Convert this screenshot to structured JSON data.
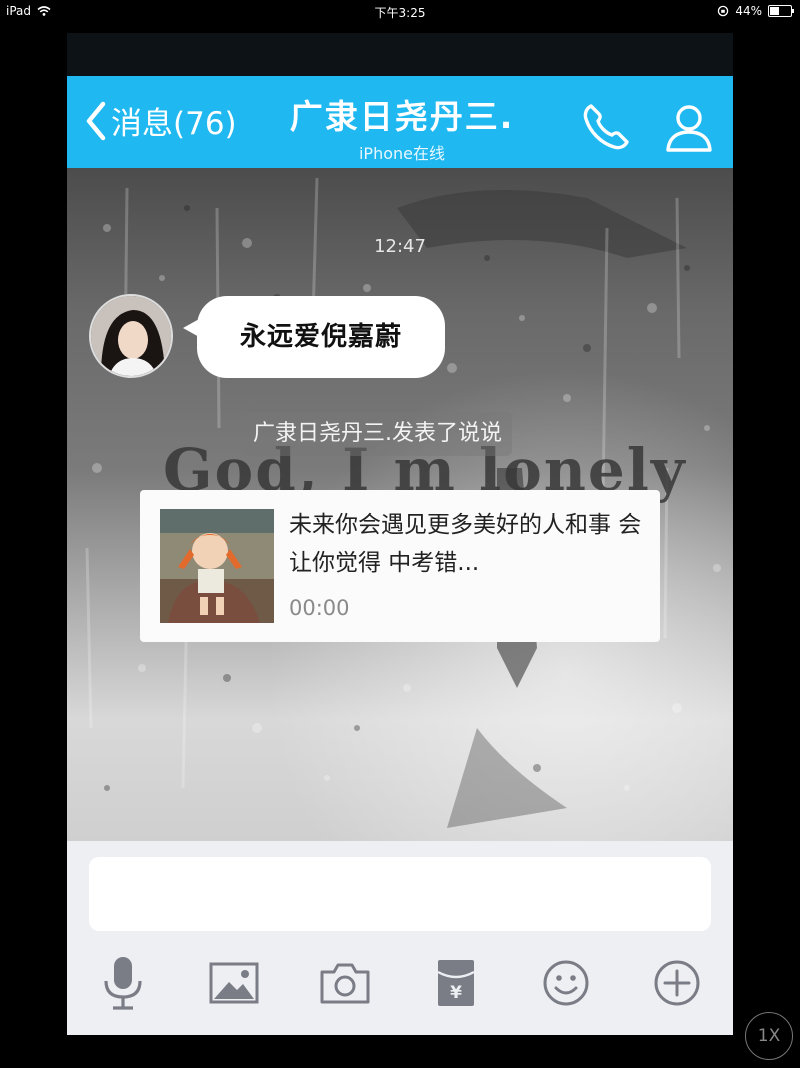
{
  "status_bar": {
    "device": "iPad",
    "time": "下午3:25",
    "battery": "44%",
    "battery_level": 0.44
  },
  "header": {
    "back_label": "消息(76)",
    "contact_name": "广隶日尧丹三.",
    "contact_status": "iPhone在线",
    "accent_color": "#1fb8f0",
    "icons": [
      "chevron-left-icon",
      "phone-icon",
      "user-profile-icon"
    ]
  },
  "chat": {
    "timestamp": "12:47",
    "message": "永远爱倪嘉蔚",
    "notice": "广隶日尧丹三.发表了说说",
    "background_text": "God, I m lonely",
    "card": {
      "text": "未来你会遇见更多美好的人和事 会让你觉得 中考错...",
      "time": "00:00"
    }
  },
  "input": {
    "value": "",
    "tools": [
      "microphone-icon",
      "image-icon",
      "camera-icon",
      "red-packet-icon",
      "emoji-icon",
      "plus-icon"
    ]
  },
  "zoom": {
    "label": "1X"
  }
}
